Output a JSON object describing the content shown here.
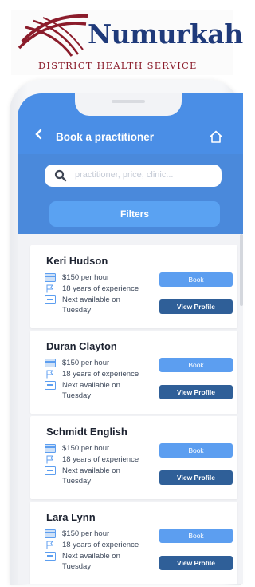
{
  "logo": {
    "brand_name": "Numurkah",
    "tagline": "DISTRICT HEALTH SERVICE"
  },
  "header": {
    "back_icon": "chevron-left-icon",
    "title": "Book a practitioner",
    "home_icon": "home-icon"
  },
  "search": {
    "placeholder": "practitioner, price, clinic..."
  },
  "filters_label": "Filters",
  "practitioners": [
    {
      "name": "Keri Hudson",
      "price": "$150 per hour",
      "experience": "18 years of experience",
      "availability": "Next available on Tuesday",
      "book_label": "Book",
      "view_label": "View Profile"
    },
    {
      "name": "Duran Clayton",
      "price": "$150 per hour",
      "experience": "18 years of experience",
      "availability": "Next available on Tuesday",
      "book_label": "Book",
      "view_label": "View Profile"
    },
    {
      "name": "Schmidt English",
      "price": "$150 per hour",
      "experience": "18 years of experience",
      "availability": "Next available on Tuesday",
      "book_label": "Book",
      "view_label": "View Profile"
    },
    {
      "name": "Lara Lynn",
      "price": "$150 per hour",
      "experience": "18 years of experience",
      "availability": "Next available on Tuesday",
      "book_label": "Book",
      "view_label": "View Profile"
    }
  ],
  "colors": {
    "header": "#4a8ee6",
    "book_button": "#5c9ef0",
    "view_profile_button": "#2f5f98",
    "brand_blue": "#1f3a7a",
    "brand_red": "#8b1c2b"
  }
}
